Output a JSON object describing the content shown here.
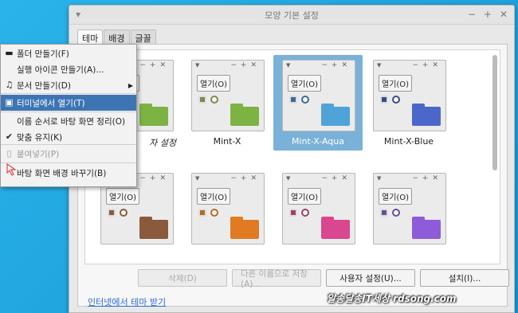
{
  "window": {
    "title": "모양 기본 설정",
    "tabs": [
      {
        "label": "테마"
      },
      {
        "label": "배경"
      },
      {
        "label": "글꼴"
      }
    ]
  },
  "themes": [
    {
      "name": "",
      "open_label": "열기(O)",
      "folder_color": "#7cb342",
      "selected": false
    },
    {
      "name": "Mint-X",
      "open_label": "열기(O)",
      "folder_color": "#7cb342",
      "selected": false
    },
    {
      "name": "Mint-X-Aqua",
      "open_label": "열기(O)",
      "folder_color": "#4fa3d8",
      "selected": true
    },
    {
      "name": "Mint-X-Blue",
      "open_label": "열기(O)",
      "folder_color": "#4a67c9",
      "selected": false
    },
    {
      "name": "",
      "open_label": "열기(O)",
      "folder_color": "#8a5a3c",
      "selected": false
    },
    {
      "name": "",
      "open_label": "열기(O)",
      "folder_color": "#e07a23",
      "selected": false
    },
    {
      "name": "",
      "open_label": "열기(O)",
      "folder_color": "#d9478f",
      "selected": false
    },
    {
      "name": "",
      "open_label": "열기(O)",
      "folder_color": "#8e5cd9",
      "selected": false
    }
  ],
  "partial_theme_label": "자 설정",
  "buttons": {
    "delete": "삭제(D)",
    "save_as": "다른 이름으로 저장(A)...",
    "custom": "사용자 설정(U)...",
    "install": "설치(I)..."
  },
  "link": "인터넷에서 테마 받기",
  "watermark": "알송달송IT세상 rdsong.com",
  "context_menu": [
    {
      "label": "폴더 만들기(F)",
      "icon": "folder-icon",
      "state": "normal",
      "submenu": false
    },
    {
      "label": "실행 아이콘 만들기(A)...",
      "icon": "",
      "state": "normal",
      "submenu": false
    },
    {
      "label": "문서 만들기(D)",
      "icon": "document-icon",
      "state": "normal",
      "submenu": true
    },
    {
      "label": "터미널에서 열기(T)",
      "icon": "terminal-icon",
      "state": "highlighted",
      "submenu": false
    },
    {
      "label": "이름 순서로 바탕 화면 정리(O)",
      "icon": "",
      "state": "normal",
      "submenu": false
    },
    {
      "label": "맞춤 유지(K)",
      "icon": "check-icon",
      "state": "normal",
      "submenu": false
    },
    {
      "label": "붙여넣기(P)",
      "icon": "paste-icon",
      "state": "disabled",
      "submenu": false
    },
    {
      "label": "바탕 화면 배경 바꾸기(B)",
      "icon": "",
      "state": "normal",
      "submenu": false
    }
  ]
}
